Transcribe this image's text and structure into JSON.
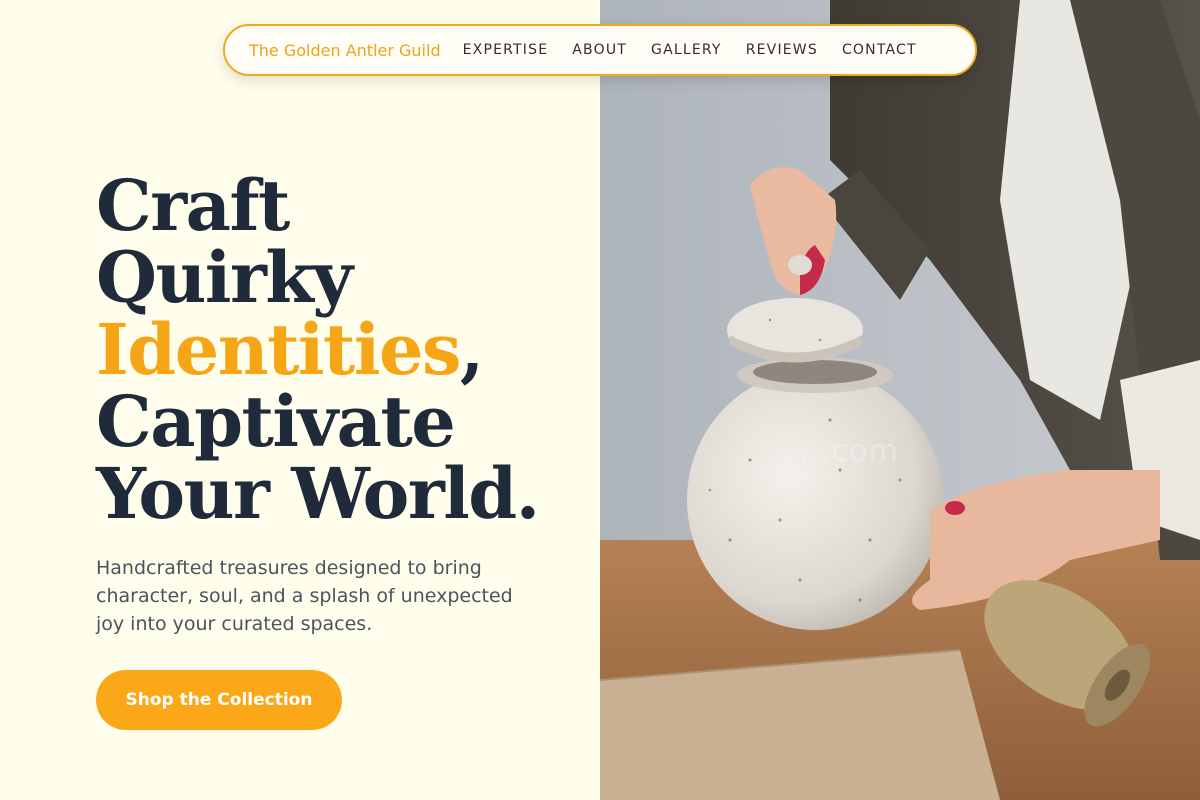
{
  "nav": {
    "brand": "The Golden Antler Guild",
    "links": [
      "EXPERTISE",
      "ABOUT",
      "GALLERY",
      "REVIEWS",
      "CONTACT"
    ]
  },
  "hero": {
    "headline": {
      "line1": "Craft",
      "line2": "Quirky",
      "accent_word": "Identities",
      "accent_punct": ",",
      "line4": "Captivate",
      "line5": "Your World."
    },
    "subtext": "Handcrafted treasures designed to bring character, soul, and a splash of unexpected joy into your curated spaces.",
    "cta_label": "Shop the Collection"
  },
  "photo": {
    "subject": "hands-lifting-lid-of-speckled-ceramic-jar",
    "watermark": "...com"
  },
  "colors": {
    "accent": "#f6a516",
    "heading": "#1f2a3a",
    "background": "#fffeec",
    "cta": "#fba818"
  }
}
